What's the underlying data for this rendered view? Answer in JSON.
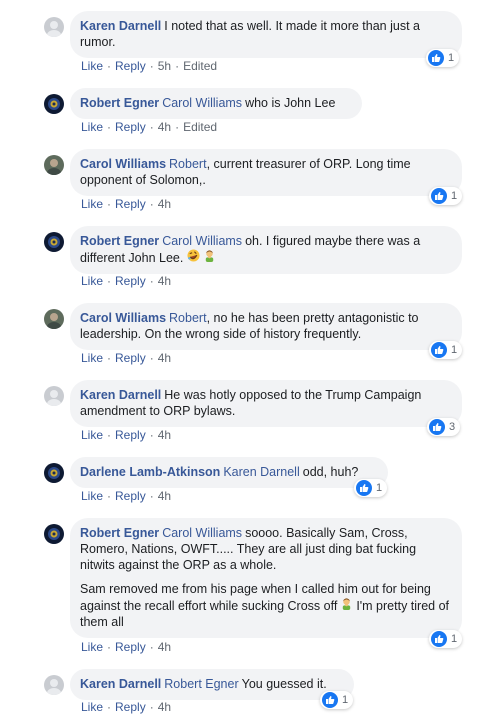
{
  "colors": {
    "link": "#385898",
    "bubble": "#f2f3f5",
    "like": "#1877f2",
    "meta": "#606770"
  },
  "comments": [
    {
      "author": "Karen Darnell",
      "mention": "",
      "text": "I noted that as well. It made it more than just a rumor.",
      "actions": {
        "like": "Like",
        "reply": "Reply",
        "time": "5h",
        "edited": "Edited"
      },
      "reactions": "1"
    },
    {
      "author": "Robert Egner",
      "mention": "Carol Williams",
      "text": "who is John Lee",
      "actions": {
        "like": "Like",
        "reply": "Reply",
        "time": "4h",
        "edited": "Edited"
      },
      "reactions": ""
    },
    {
      "author": "Carol Williams",
      "mention": "Robert",
      "text": ", current treasurer of ORP. Long time opponent of Solomon,.",
      "actions": {
        "like": "Like",
        "reply": "Reply",
        "time": "4h",
        "edited": ""
      },
      "reactions": "1"
    },
    {
      "author": "Robert Egner",
      "mention": "Carol Williams",
      "text": "oh. I figured maybe there was a different John Lee.",
      "emojis": [
        "rofl-emoji",
        "facepalm-emoji"
      ],
      "actions": {
        "like": "Like",
        "reply": "Reply",
        "time": "4h",
        "edited": ""
      },
      "reactions": ""
    },
    {
      "author": "Carol Williams",
      "mention": "Robert",
      "text": ", no he has been pretty antagonistic to leadership. On the wrong side of history frequently.",
      "actions": {
        "like": "Like",
        "reply": "Reply",
        "time": "4h",
        "edited": ""
      },
      "reactions": "1"
    },
    {
      "author": "Karen Darnell",
      "mention": "",
      "text": "He was hotly opposed to the Trump Campaign amendment to ORP bylaws.",
      "actions": {
        "like": "Like",
        "reply": "Reply",
        "time": "4h",
        "edited": ""
      },
      "reactions": "3"
    },
    {
      "author": "Darlene Lamb-Atkinson",
      "mention": "Karen Darnell",
      "text": "odd, huh?",
      "actions": {
        "like": "Like",
        "reply": "Reply",
        "time": "4h",
        "edited": ""
      },
      "reactions": "1"
    },
    {
      "author": "Robert Egner",
      "mention": "Carol Williams",
      "text": "soooo. Basically Sam, Cross, Romero, Nations, OWFT..... They are all just ding bat fucking nitwits against the ORP as a whole.",
      "text2a": "Sam removed me from his page when I called him out for being against the recall effort while sucking Cross off",
      "text2b": "I'm pretty tired of them all",
      "actions": {
        "like": "Like",
        "reply": "Reply",
        "time": "4h",
        "edited": ""
      },
      "reactions": "1"
    },
    {
      "author": "Karen Darnell",
      "mention": "Robert Egner",
      "text": "You guessed it.",
      "actions": {
        "like": "Like",
        "reply": "Reply",
        "time": "4h",
        "edited": ""
      },
      "reactions": "1"
    }
  ]
}
